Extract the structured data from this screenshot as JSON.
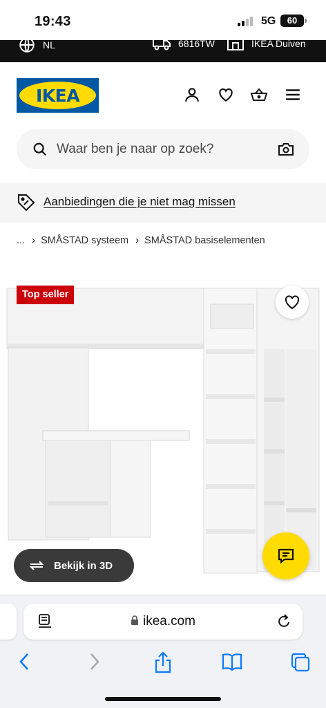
{
  "status_bar": {
    "time": "19:43",
    "network": "5G",
    "battery": "60"
  },
  "top_bar": {
    "language": "NL",
    "postal_code": "6816TW",
    "store": "IKEA Duiven"
  },
  "header": {
    "logo_text": "IKEA",
    "icons": [
      "account-icon",
      "heart-icon",
      "basket-icon",
      "menu-icon"
    ]
  },
  "search": {
    "placeholder": "Waar ben je naar op zoek?"
  },
  "promo": {
    "text": "Aanbiedingen die je niet mag missen"
  },
  "breadcrumb": {
    "items": [
      "...",
      "SMÅSTAD systeem",
      "SMÅSTAD basiselementen"
    ]
  },
  "product": {
    "badge": "Top seller",
    "view_3d_label": "Bekijk in 3D"
  },
  "browser": {
    "url": "ikea.com"
  },
  "colors": {
    "ikea_blue": "#0058a3",
    "ikea_yellow": "#ffdb00",
    "badge_red": "#cc0008",
    "safari_blue": "#0a7aff"
  }
}
